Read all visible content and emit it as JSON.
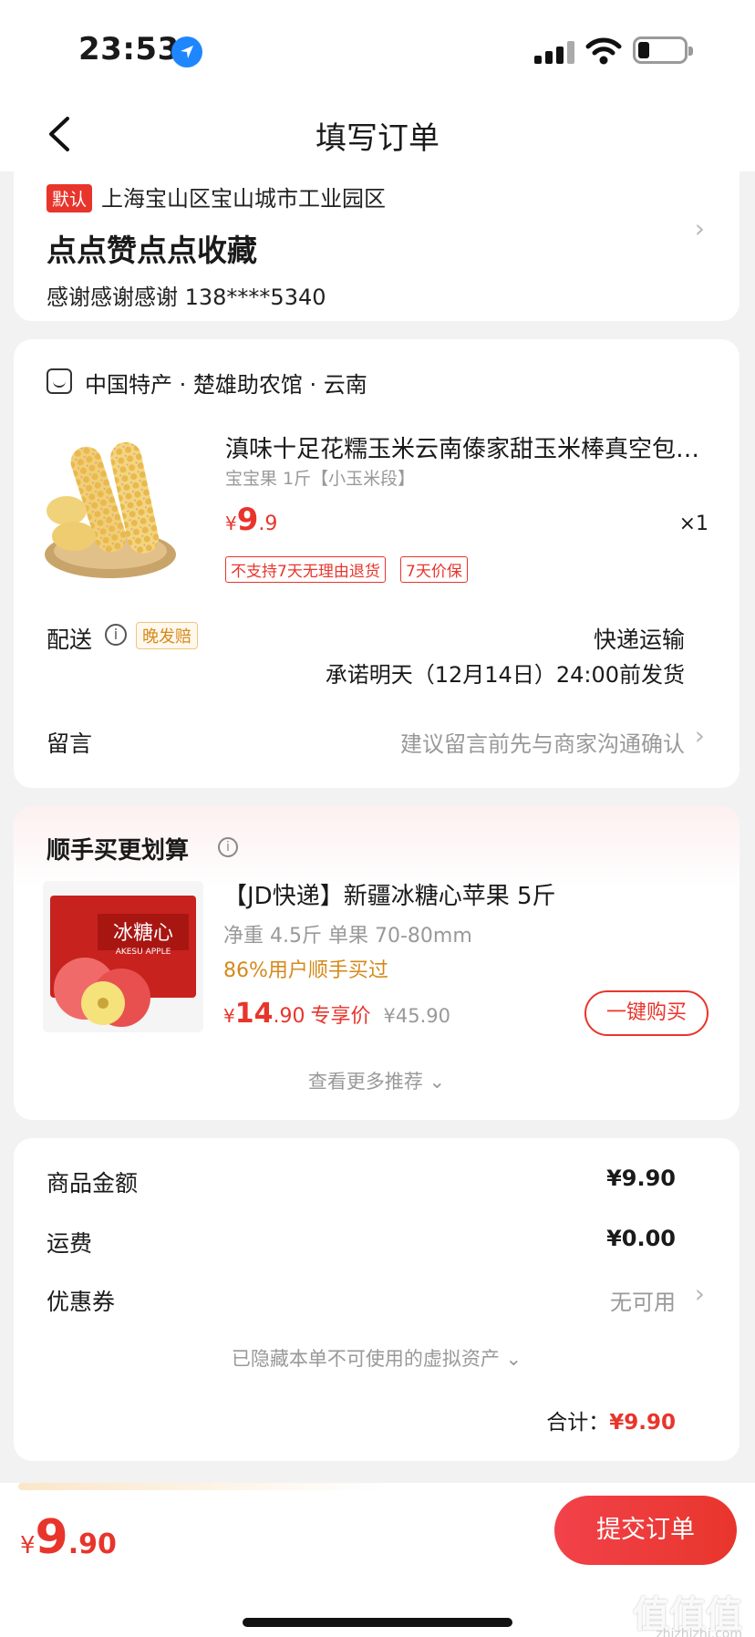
{
  "status_bar": {
    "time": "23:53"
  },
  "nav": {
    "title": "填写订单"
  },
  "address": {
    "default_tag": "默认",
    "line": "上海宝山区宝山城市工业园区",
    "name": "点点赞点点收藏",
    "contact": "感谢感谢感谢  138****5340"
  },
  "shop": {
    "name": "中国特产 · 楚雄助农馆 · 云南"
  },
  "product": {
    "title": "滇味十足花糯玉米云南傣家甜玉米棒真空包…",
    "spec": "宝宝果 1斤【小玉米段】",
    "price_symbol": "¥",
    "price_int": "9",
    "price_dec": ".9",
    "qty": "×1",
    "badges": [
      "不支持7天无理由退货",
      "7天价保"
    ]
  },
  "shipping": {
    "label": "配送",
    "late_badge": "晚发赔",
    "method": "快递运输",
    "promise": "承诺明天（12月14日）24:00前发货"
  },
  "note": {
    "label": "留言",
    "hint": "建议留言前先与商家沟通确认"
  },
  "recommend": {
    "title": "顺手买更划算",
    "item_name": "【JD快递】新疆冰糖心苹果 5斤",
    "weight": "净重 4.5斤 单果 70-80mm",
    "social": "86%用户顺手买过",
    "price_symbol": "¥",
    "price_int": "14",
    "price_dec": ".90",
    "price_tag": "专享价",
    "orig_price": "¥45.90",
    "buy_label": "一键购买",
    "more_label": "查看更多推荐 ⌄",
    "img_text": "冰糖心",
    "img_sub": "AKESU APPLE"
  },
  "summary": {
    "rows": [
      {
        "label": "商品金额",
        "value": "¥9.90"
      },
      {
        "label": "运费",
        "value": "¥0.00"
      },
      {
        "label": "优惠券",
        "value": "无可用"
      }
    ],
    "hidden_hint": "已隐藏本单不可使用的虚拟资产 ⌄",
    "total_label": "合计：",
    "total_value": "¥9.90"
  },
  "bottom": {
    "price_symbol": "¥",
    "price_int": "9",
    "price_dec": ".90",
    "submit_label": "提交订单"
  },
  "watermark": {
    "text": "值值值",
    "sub": "zhizhizhi.com"
  },
  "colors": {
    "accent": "#e8352c",
    "warning": "#d48a1c",
    "background": "#f2f2f2"
  }
}
